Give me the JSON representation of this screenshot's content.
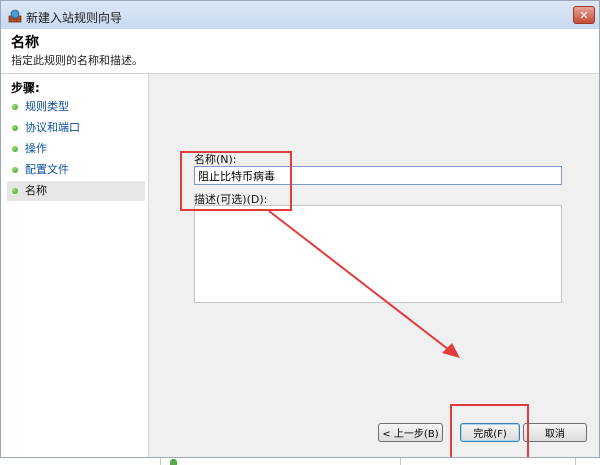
{
  "window": {
    "title": "新建入站规则向导",
    "close_label": "✕"
  },
  "header": {
    "title": "名称",
    "subtitle": "指定此规则的名称和描述。"
  },
  "steps": {
    "title": "步骤:",
    "items": [
      {
        "label": "规则类型"
      },
      {
        "label": "协议和端口"
      },
      {
        "label": "操作"
      },
      {
        "label": "配置文件"
      },
      {
        "label": "名称"
      }
    ]
  },
  "form": {
    "name_label": "名称(N):",
    "name_value": "阻止比特币病毒",
    "desc_label": "描述(可选)(D):",
    "desc_value": ""
  },
  "buttons": {
    "back": "< 上一步(B)",
    "finish": "完成(F)",
    "cancel": "取消"
  },
  "colors": {
    "annotation": "#e03c3c",
    "link": "#0b4f9c",
    "step_bullet": "#3a9a1e"
  }
}
